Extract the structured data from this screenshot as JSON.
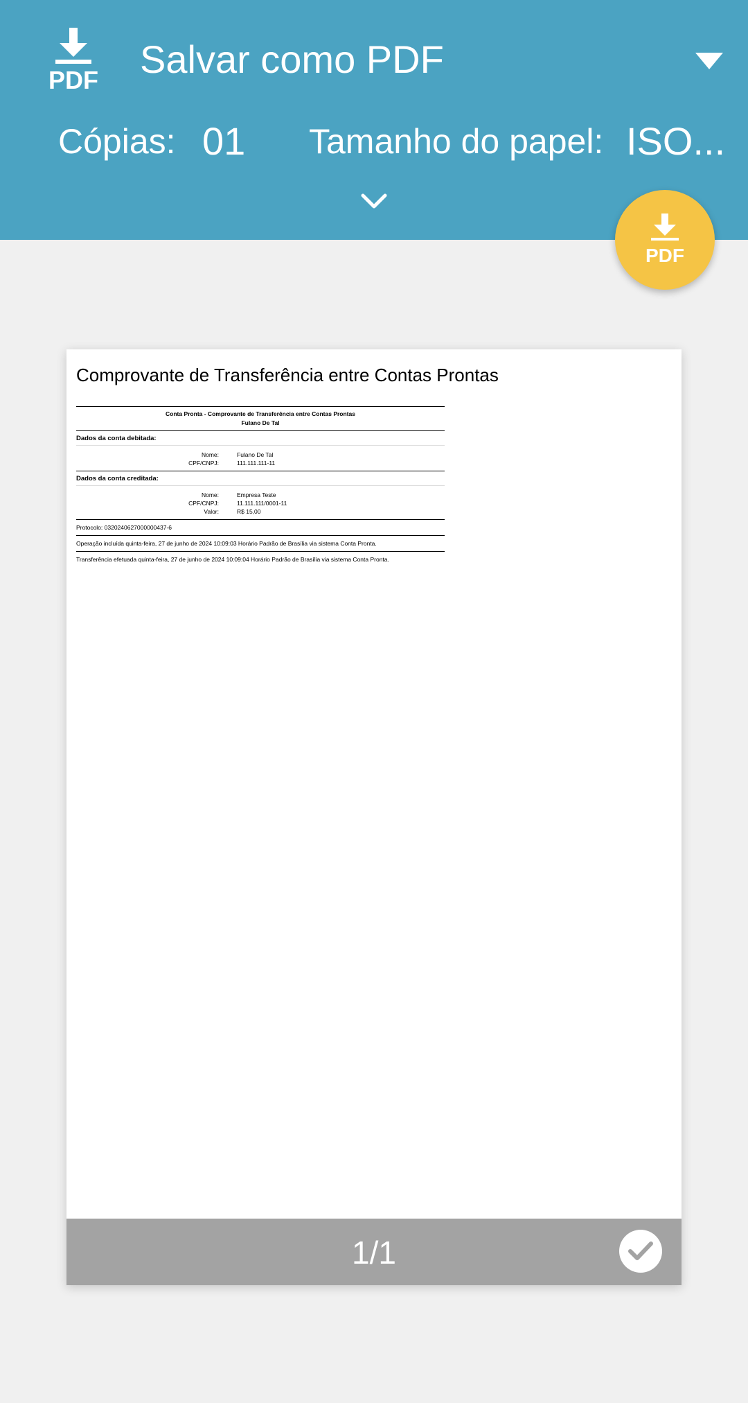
{
  "header": {
    "destination_icon": "pdf-download-icon",
    "destination_label": "Salvar como PDF",
    "dropdown_icon": "triangle-down-icon",
    "copies_label": "Cópias:",
    "copies_value": "01",
    "paper_size_label": "Tamanho do papel:",
    "paper_size_value": "ISO...",
    "expand_icon": "chevron-down-icon",
    "background_color": "#4ba3c2"
  },
  "fab": {
    "icon": "pdf-download-icon",
    "icon_text": "PDF",
    "color": "#f5c445"
  },
  "preview": {
    "title": "Comprovante de Transferência entre Contas Prontas",
    "receipt": {
      "header_line1": "Conta Pronta - Comprovante de Transferência entre Contas Prontas",
      "header_line2": "Fulano De Tal",
      "debit_section": "Dados da conta debitada:",
      "debit_name_key": "Nome:",
      "debit_name_value": "Fulano De Tal",
      "debit_doc_key": "CPF/CNPJ:",
      "debit_doc_value": "111.111.111-11",
      "credit_section": "Dados da conta creditada:",
      "credit_name_key": "Nome:",
      "credit_name_value": "Empresa Teste",
      "credit_doc_key": "CPF/CNPJ:",
      "credit_doc_value": "11.111.111/0001-11",
      "credit_value_key": "Valor:",
      "credit_value_value": "R$ 15,00",
      "protocol": "Protocolo: 0320240627000000437-6",
      "operation": "Operação incluída quinta-feira, 27 de junho de 2024 10:09:03 Horário Padrão de Brasília via sistema Conta Pronta.",
      "transfer": "Transferência efetuada quinta-feira, 27 de junho de 2024 10:09:04 Horário Padrão de Brasília via sistema Conta Pronta."
    },
    "page_counter": "1/1",
    "selected_icon": "check-icon"
  }
}
